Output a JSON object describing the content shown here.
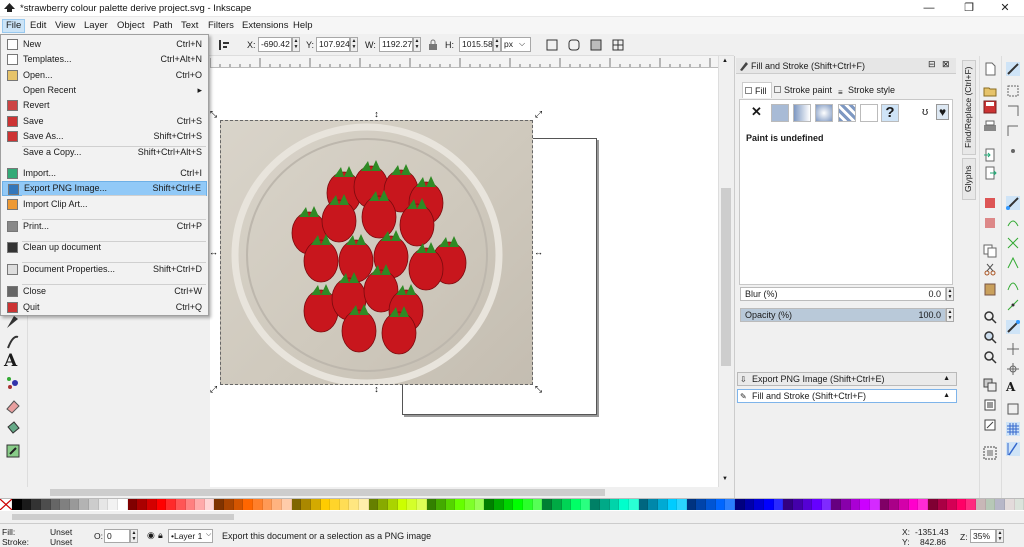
{
  "window": {
    "title": "*strawberry colour palette derive project.svg - Inkscape",
    "minimize": "—",
    "maximize": "❐",
    "close": "✕"
  },
  "menubar": [
    "File",
    "Edit",
    "View",
    "Layer",
    "Object",
    "Path",
    "Text",
    "Filters",
    "Extensions",
    "Help"
  ],
  "file_menu": [
    {
      "label": "New",
      "shortcut": "Ctrl+N",
      "icon": "new-document-icon"
    },
    {
      "label": "Templates...",
      "shortcut": "Ctrl+Alt+N",
      "icon": "templates-icon"
    },
    {
      "label": "Open...",
      "shortcut": "Ctrl+O",
      "icon": "open-folder-icon"
    },
    {
      "label": "Open Recent",
      "shortcut": "▸",
      "icon": ""
    },
    {
      "label": "Revert",
      "shortcut": "",
      "icon": "revert-icon"
    },
    {
      "label": "Save",
      "shortcut": "Ctrl+S",
      "icon": "save-icon"
    },
    {
      "label": "Save As...",
      "shortcut": "Shift+Ctrl+S",
      "icon": "save-as-icon"
    },
    {
      "label": "Save a Copy...",
      "shortcut": "Shift+Ctrl+Alt+S",
      "icon": ""
    },
    {
      "label": "Import...",
      "shortcut": "Ctrl+I",
      "icon": "import-icon"
    },
    {
      "label": "Export PNG Image...",
      "shortcut": "Shift+Ctrl+E",
      "icon": "export-png-icon"
    },
    {
      "label": "Import Clip Art...",
      "shortcut": "",
      "icon": "clip-art-icon"
    },
    {
      "label": "Print...",
      "shortcut": "Ctrl+P",
      "icon": "print-icon"
    },
    {
      "label": "Clean up document",
      "shortcut": "",
      "icon": "clean-up-icon"
    },
    {
      "label": "Document Properties...",
      "shortcut": "Shift+Ctrl+D",
      "icon": "document-properties-icon"
    },
    {
      "label": "Close",
      "shortcut": "Ctrl+W",
      "icon": "close-document-icon"
    },
    {
      "label": "Quit",
      "shortcut": "Ctrl+Q",
      "icon": "quit-icon"
    }
  ],
  "controls": {
    "x_label": "X:",
    "x_value": "-690.42",
    "y_label": "Y:",
    "y_value": "107.924",
    "w_label": "W:",
    "w_value": "1192.27",
    "h_label": "H:",
    "h_value": "1015.58",
    "unit": "px"
  },
  "panel": {
    "title": "Fill and Stroke (Shift+Ctrl+F)",
    "tabs": [
      "Fill",
      "Stroke paint",
      "Stroke style"
    ],
    "paint_undefined": "Paint is undefined",
    "blur_label": "Blur (%)",
    "blur_value": "0.0",
    "opacity_label": "Opacity (%)",
    "opacity_value": "100.0",
    "opacity_fraction": 1.0,
    "collapsed_dialogs": [
      "Export PNG Image (Shift+Ctrl+E)",
      "Fill and Stroke (Shift+Ctrl+F)"
    ],
    "side_tabs": [
      "Find/Replace (Ctrl+F)",
      "Glyphs"
    ]
  },
  "status": {
    "fill_label": "Fill:",
    "fill_value": "Unset",
    "stroke_label": "Stroke:",
    "stroke_value": "Unset",
    "opacity_label": "O:",
    "opacity_value": "0",
    "layer": "•Layer 1",
    "message": "Export this document or a selection as a PNG image",
    "x_label": "X:",
    "x_value": "-1351.43",
    "y_label": "Y:",
    "y_value": "842.86",
    "zoom_label": "Z:",
    "zoom_value": "35%"
  },
  "palette_colors": [
    "#000000",
    "#1a1a1a",
    "#333333",
    "#4d4d4d",
    "#666666",
    "#808080",
    "#999999",
    "#b3b3b3",
    "#cccccc",
    "#e6e6e6",
    "#f2f2f2",
    "#ffffff",
    "#800000",
    "#aa0000",
    "#d40000",
    "#ff0000",
    "#ff2a2a",
    "#ff5555",
    "#ff8080",
    "#ffaaaa",
    "#ffd5d5",
    "#803300",
    "#aa4400",
    "#d45500",
    "#ff6600",
    "#ff7f2a",
    "#ff9955",
    "#ffb380",
    "#ffccaa",
    "#806600",
    "#aa8800",
    "#d4aa00",
    "#ffcc00",
    "#ffd42a",
    "#ffdd55",
    "#ffe680",
    "#ffeeaa",
    "#668000",
    "#88aa00",
    "#aad400",
    "#ccff00",
    "#d4ff2a",
    "#ddff55",
    "#338000",
    "#44aa00",
    "#55d400",
    "#66ff00",
    "#7fff2a",
    "#99ff55",
    "#008000",
    "#00aa00",
    "#00d400",
    "#00ff00",
    "#2aff2a",
    "#55ff55",
    "#008033",
    "#00aa44",
    "#00d455",
    "#00ff66",
    "#2aff80",
    "#008066",
    "#00aa88",
    "#00d4aa",
    "#00ffcc",
    "#2affd5",
    "#006680",
    "#0088aa",
    "#00aad4",
    "#00ccff",
    "#2ad4ff",
    "#003380",
    "#0044aa",
    "#0055d4",
    "#0066ff",
    "#2a7fff",
    "#000080",
    "#0000aa",
    "#0000d4",
    "#0000ff",
    "#2a2aff",
    "#330080",
    "#4400aa",
    "#5500d4",
    "#6600ff",
    "#7f2aff",
    "#660080",
    "#8800aa",
    "#aa00d4",
    "#cc00ff",
    "#d42aff",
    "#800066",
    "#aa0088",
    "#d400aa",
    "#ff00cc",
    "#ff2ad4",
    "#800033",
    "#aa0044",
    "#d40055",
    "#ff0066",
    "#ff2a7f",
    "#c8b7b7",
    "#b7c8b7",
    "#b7b7c8",
    "#e3dbdb",
    "#dbe3db"
  ]
}
